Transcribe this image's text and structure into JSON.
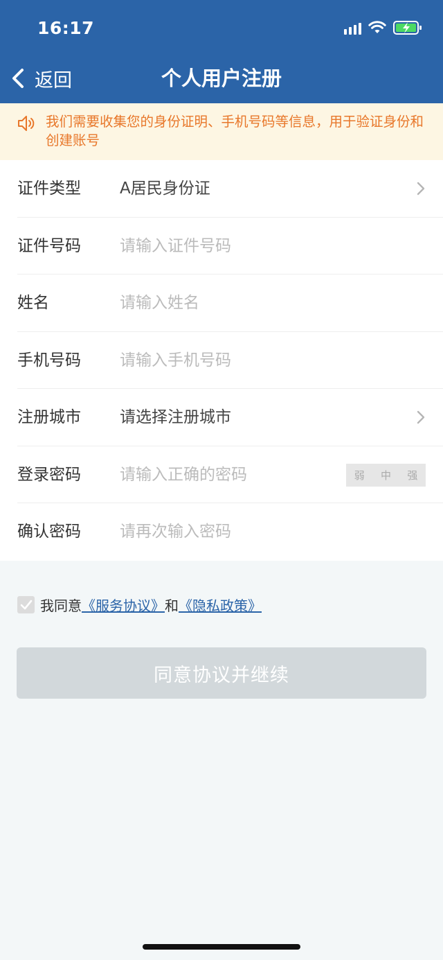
{
  "status_bar": {
    "time": "16:17"
  },
  "nav": {
    "back_label": "返回",
    "title": "个人用户注册"
  },
  "notice": {
    "text": "我们需要收集您的身份证明、手机号码等信息，用于验证身份和创建账号"
  },
  "form": {
    "id_type": {
      "label": "证件类型",
      "value": "A居民身份证"
    },
    "id_number": {
      "label": "证件号码",
      "placeholder": "请输入证件号码"
    },
    "name": {
      "label": "姓名",
      "placeholder": "请输入姓名"
    },
    "phone": {
      "label": "手机号码",
      "placeholder": "请输入手机号码"
    },
    "city": {
      "label": "注册城市",
      "value": "请选择注册城市"
    },
    "password": {
      "label": "登录密码",
      "placeholder": "请输入正确的密码",
      "strength": [
        "弱",
        "中",
        "强"
      ]
    },
    "confirm": {
      "label": "确认密码",
      "placeholder": "请再次输入密码"
    }
  },
  "agreement": {
    "prefix": "我同意",
    "service_link": "《服务协议》",
    "and": "和",
    "privacy_link": "《隐私政策》",
    "checked": true
  },
  "continue_button": "同意协议并继续",
  "colors": {
    "brand": "#2b64a8",
    "notice_text": "#e8772a",
    "notice_bg": "#fdf6e3",
    "button_disabled": "#d2d8db"
  },
  "icons": [
    "chevron-left-icon",
    "speaker-icon",
    "chevron-right-icon",
    "signal-icon",
    "wifi-icon",
    "battery-charging-icon",
    "checkbox-check-icon"
  ]
}
